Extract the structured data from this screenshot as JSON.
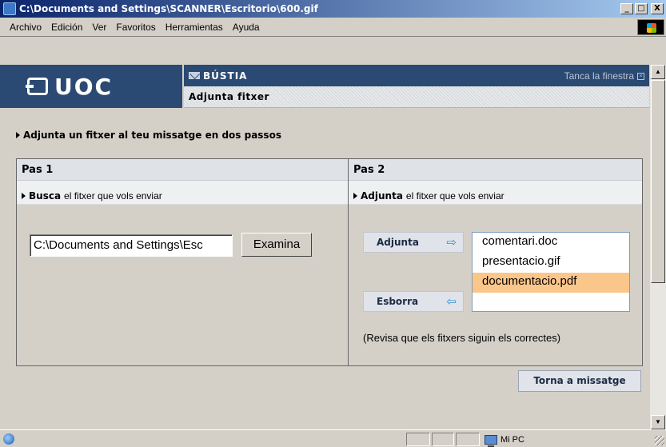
{
  "window": {
    "title": "C:\\Documents and Settings\\SCANNER\\Escritorio\\600.gif",
    "minimize": "_",
    "maximize": "□",
    "close": "X"
  },
  "menu": [
    "Archivo",
    "Edición",
    "Ver",
    "Favoritos",
    "Herramientas",
    "Ayuda"
  ],
  "header": {
    "logo": "UOC",
    "section": "BÚSTIA",
    "close_window": "Tanca la finestra",
    "close_glyph": "×",
    "subtitle": "Adjunta fitxer"
  },
  "instruction": "Adjunta un fitxer al teu missatge en dos passos",
  "step1": {
    "title": "Pas 1",
    "desc_bold": "Busca",
    "desc_rest": "el fitxer que vols enviar",
    "file_value": "C:\\Documents and Settings\\Esc",
    "browse_label": "Examina"
  },
  "step2": {
    "title": "Pas 2",
    "desc_bold": "Adjunta",
    "desc_rest": "el fitxer que vols enviar",
    "add_label": "Adjunta",
    "add_arrow": "⇨",
    "delete_label": "Esborra",
    "delete_arrow": "⇦",
    "files": [
      "comentari.doc",
      "presentacio.gif",
      "documentacio.pdf"
    ],
    "selected_index": 2,
    "note": "(Revisa que els fitxers siguin els correctes)"
  },
  "back_button": "Torna a missatge",
  "status": {
    "zone": "Mi PC"
  },
  "scroll": {
    "up": "▲",
    "down": "▼"
  }
}
